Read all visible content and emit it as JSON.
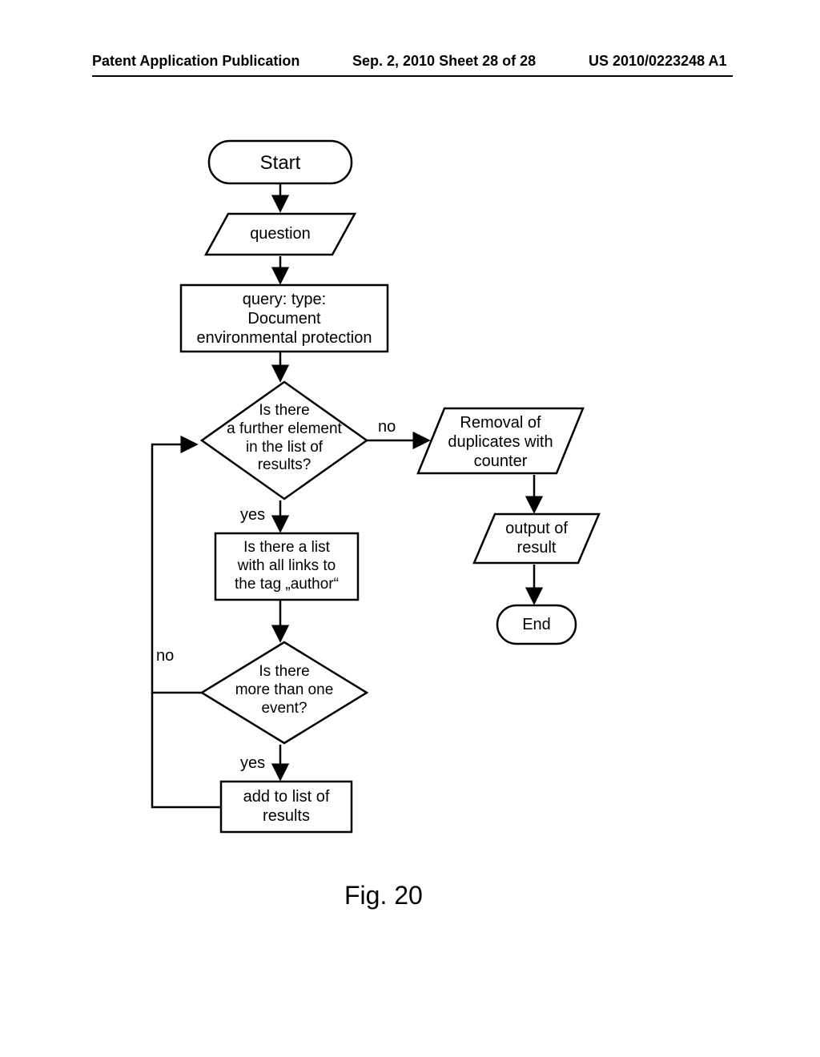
{
  "header": {
    "left": "Patent Application Publication",
    "mid": "Sep. 2, 2010  Sheet 28 of 28",
    "right": "US 2010/0223248 A1"
  },
  "nodes": {
    "start": "Start",
    "question": "question",
    "query": "query: type:\nDocument\nenvironmental protection",
    "dec1": "Is there\na further element\nin the list of\nresults?",
    "proc2": "Is there a list\nwith all links to\nthe tag „author“",
    "dec2": "Is there\nmore than one\nevent?",
    "add": "add to list of\nresults",
    "removal": "Removal of\nduplicates with\ncounter",
    "output": "output of\nresult",
    "end": "End"
  },
  "edges": {
    "dec1_no": "no",
    "dec1_yes": "yes",
    "dec2_no": "no",
    "dec2_yes": "yes"
  },
  "figure_label": "Fig. 20"
}
